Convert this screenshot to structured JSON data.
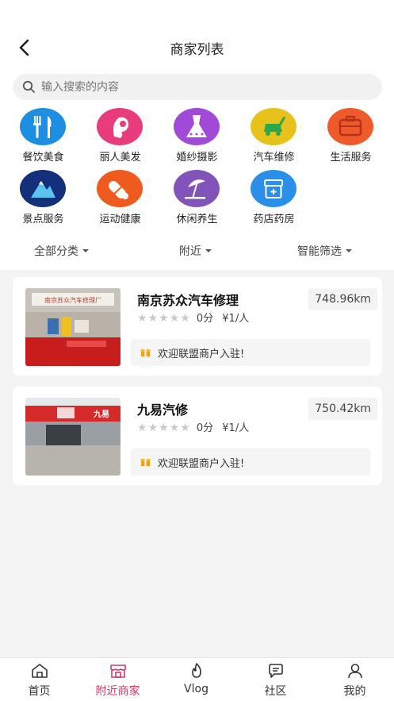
{
  "header": {
    "title": "商家列表"
  },
  "search": {
    "placeholder": "输入搜索的内容",
    "value": ""
  },
  "categories": [
    {
      "label": "餐饮美食",
      "icon": "cutlery-icon",
      "color": "#1e8fe0"
    },
    {
      "label": "丽人美发",
      "icon": "hair-beauty-icon",
      "color": "#e83c7c"
    },
    {
      "label": "婚纱摄影",
      "icon": "wedding-dress-icon",
      "color": "#a24ad8"
    },
    {
      "label": "汽车维修",
      "icon": "car-repair-icon",
      "color": "#e8c21c"
    },
    {
      "label": "生活服务",
      "icon": "life-service-icon",
      "color": "#ee5a2a"
    },
    {
      "label": "景点服务",
      "icon": "mountain-icon",
      "color": "#15307a"
    },
    {
      "label": "运动健康",
      "icon": "sport-health-icon",
      "color": "#ef5a1e"
    },
    {
      "label": "休闲养生",
      "icon": "leisure-umbrella-icon",
      "color": "#8253b8"
    },
    {
      "label": "药店药房",
      "icon": "medicine-box-icon",
      "color": "#2a8fe8"
    }
  ],
  "filters": {
    "category": "全部分类",
    "distance": "附近",
    "smart": "智能筛选"
  },
  "merchants": [
    {
      "name": "南京苏众汽车修理",
      "distance": "748.96km",
      "score": "0分",
      "price": "¥1/人",
      "promo": "欢迎联盟商户入驻!",
      "stars": 0,
      "photo_sign": "南京苏众汽车修理厂"
    },
    {
      "name": "九易汽修",
      "distance": "750.42km",
      "score": "0分",
      "price": "¥1/人",
      "promo": "欢迎联盟商户入驻!",
      "stars": 0,
      "photo_sign": "九易"
    }
  ],
  "tabbar": {
    "active": "nearby",
    "items": [
      {
        "label": "首页",
        "icon": "home-icon"
      },
      {
        "label": "附近商家",
        "icon": "store-icon"
      },
      {
        "label": "Vlog",
        "icon": "flame-icon"
      },
      {
        "label": "社区",
        "icon": "chat-bubble-icon"
      },
      {
        "label": "我的",
        "icon": "user-icon"
      }
    ]
  },
  "colors": {
    "accent": "#d23b63",
    "background": "#f4f4f5"
  }
}
